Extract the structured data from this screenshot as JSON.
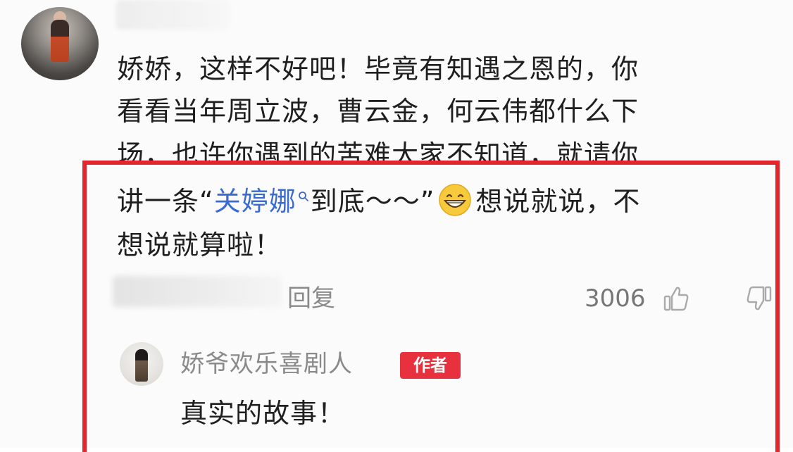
{
  "comment": {
    "lines": [
      "娇娇，这样不好吧！毕竟有知遇之恩的，你",
      "看看当年周立波，曹云金，何云伟都什么下",
      "场，也许你遇到的苦难大家不知道，就请你"
    ],
    "line4_prefix": "讲一条“",
    "link_text": "关婷娜",
    "line4_mid": "到底～～”",
    "line4_suffix": "想说就说，不",
    "line5": "想说就算啦！",
    "reply_label": "回复",
    "like_count": "3006"
  },
  "reply": {
    "username": "娇爷欢乐喜剧人",
    "badge": "作者",
    "text": "真实的故事！"
  },
  "colors": {
    "link": "#3a6bd1",
    "badge": "#e8313e",
    "highlight_frame": "#e3262e"
  },
  "icons": {
    "link_search": "search-icon",
    "emoji": "grinning-emoji-icon",
    "like": "thumbs-up-icon",
    "dislike": "thumbs-down-icon"
  }
}
